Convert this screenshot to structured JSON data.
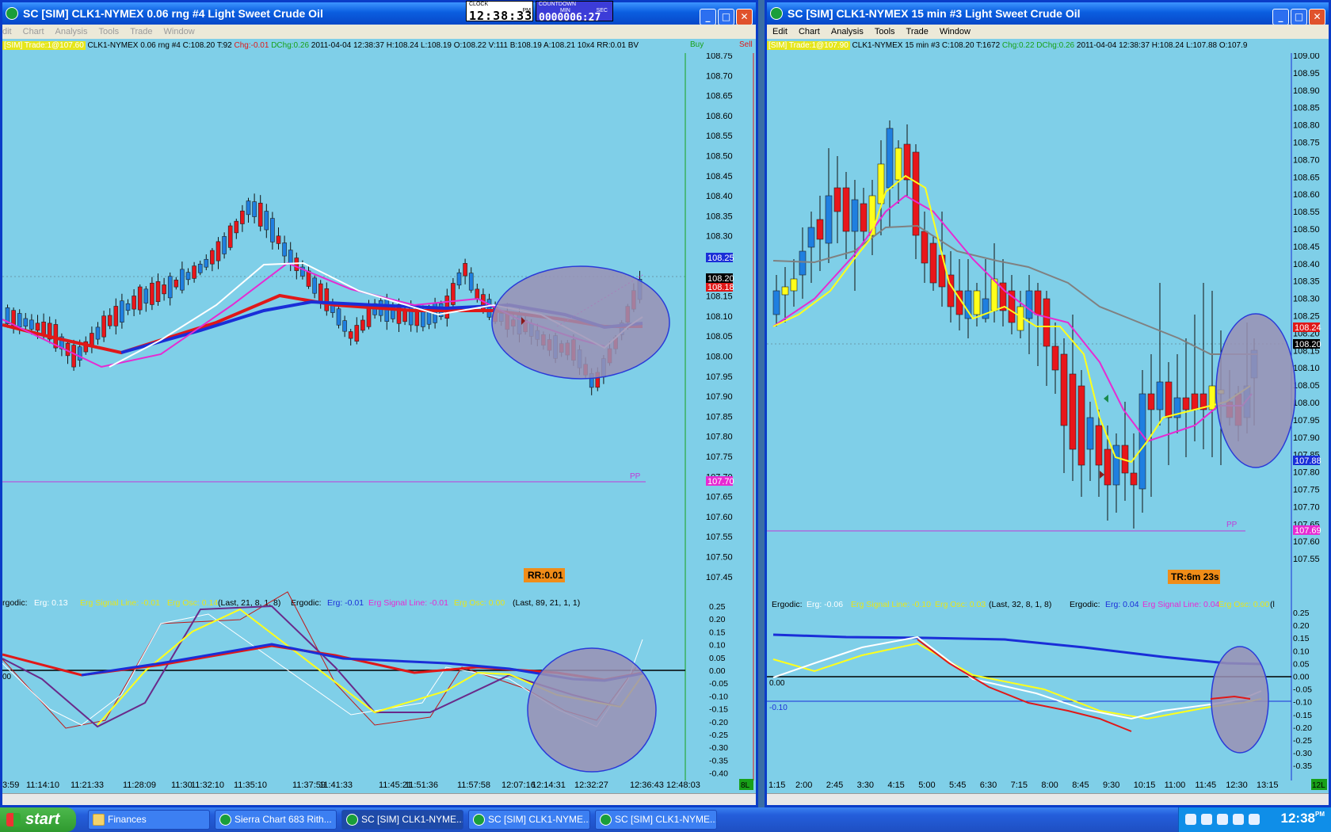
{
  "left_window": {
    "title": "SC [SIM] CLK1-NYMEX  0.06 rng  #4  Light Sweet Crude Oil",
    "menu": [
      "dit",
      "Chart",
      "Analysis",
      "Tools",
      "Trade",
      "Window"
    ],
    "info": {
      "sim": "[SIM] Trade:1@107.60",
      "symbol": "CLK1-NYMEX  0.06 rng  #4",
      "close": "C:108.20",
      "ticks": "T:92",
      "chg": "Chg:-0.01",
      "dchg": "DChg:0.26",
      "rest": "2011-04-04 12:38:37 H:108.24 L:108.19 O:108.22 V:111 B:108.19 A:108.21 10x4 RR:0.01 BV",
      "buy": "Buy",
      "sell": "Sell"
    },
    "price_ticks": [
      "108.75",
      "108.70",
      "108.65",
      "108.60",
      "108.55",
      "108.50",
      "108.45",
      "108.40",
      "108.35",
      "108.30",
      "108.25",
      "108.20",
      "108.15",
      "108.10",
      "108.05",
      "108.00",
      "107.95",
      "107.90",
      "107.85",
      "107.80",
      "107.75",
      "107.70",
      "107.65",
      "107.60",
      "107.55",
      "107.50",
      "107.45"
    ],
    "last_bid_label": "108.25",
    "last_price_label": "108.20",
    "ask_label": "108.18",
    "pp_price_label": "107.70",
    "pp_text": "PP",
    "badge": "RR:0.01",
    "osc_header": {
      "a_name": "rgodic:",
      "a_erg": "Erg: 0.13",
      "a_sig": "Erg Signal Line: -0.01",
      "a_osc": "Erg Osc: 0.14",
      "a_params": "(Last, 21, 8, 1, 8)",
      "b_name": "Ergodic:",
      "b_erg": "Erg: -0.01",
      "b_sig": "Erg Signal Line: -0.01",
      "b_osc": "Erg Osc: 0.00",
      "b_params": "(Last, 89, 21, 1, 1)"
    },
    "osc_ticks": [
      "0.25",
      "0.20",
      "0.15",
      "0.10",
      "0.05",
      "0.00",
      "-0.05",
      "-0.10",
      "-0.15",
      "-0.20",
      "-0.25",
      "-0.30",
      "-0.35",
      "-0.40"
    ],
    "osc_zero_label": "00",
    "time_labels": [
      "3:59",
      "11:14:10",
      "11:21:33",
      "11:28:09",
      "11:30",
      "11:32:10",
      "11:35:10",
      "11:37:59",
      "11:41:33",
      "11:45:21",
      "11:51:36",
      "11:57:58",
      "12:07:16",
      "12:14:31",
      "12:32:27",
      "12:36:43",
      "12:48:03"
    ],
    "corner_badge": "8L"
  },
  "right_window": {
    "title": "SC [SIM] CLK1-NYMEX  15 min  #3  Light Sweet Crude Oil",
    "menu": [
      "Edit",
      "Chart",
      "Analysis",
      "Tools",
      "Trade",
      "Window"
    ],
    "info": {
      "sim": "[SIM] Trade:1@107.90",
      "symbol": "CLK1-NYMEX  15 min",
      "rest1": "#3 C:108.20 T:1672",
      "chg": "Chg:0.22",
      "dchg": "DChg:0.26",
      "rest2": "2011-04-04 12:38:37 H:108.24 L:107.88 O:107.9"
    },
    "price_ticks": [
      "109.00",
      "108.95",
      "108.90",
      "108.85",
      "108.80",
      "108.75",
      "108.70",
      "108.65",
      "108.60",
      "108.55",
      "108.50",
      "108.45",
      "108.40",
      "108.35",
      "108.30",
      "108.25",
      "108.20",
      "108.15",
      "108.10",
      "108.05",
      "108.00",
      "107.95",
      "107.90",
      "107.85",
      "107.80",
      "107.75",
      "107.70",
      "107.65",
      "107.60",
      "107.55"
    ],
    "high_label": "108.24",
    "last_price_label": "108.20",
    "low_label": "107.88",
    "pp_price_label": "107.69",
    "pp_text": "PP",
    "badge": "TR:6m 23s",
    "osc_header": {
      "a_name": "Ergodic:",
      "a_erg": "Erg: -0.06",
      "a_sig": "Erg Signal Line: -0.10",
      "a_osc": "Erg Osc: 0.03",
      "a_params": "(Last, 32, 8, 1, 8)",
      "b_name": "Ergodic:",
      "b_erg": "Erg: 0.04",
      "b_sig": "Erg Signal Line: 0.04",
      "b_osc": "Erg Osc: 0.00",
      "b_params": "(l"
    },
    "osc_ticks": [
      "0.25",
      "0.20",
      "0.15",
      "0.10",
      "0.05",
      "0.00",
      "-0.05",
      "-0.10",
      "-0.15",
      "-0.20",
      "-0.25",
      "-0.30",
      "-0.35"
    ],
    "osc_zero_label": "0.00",
    "osc_ref_label": "-0.10",
    "time_labels": [
      "1:15",
      "2:00",
      "2:45",
      "3:30",
      "4:15",
      "5:00",
      "5:45",
      "6:30",
      "7:15",
      "8:00",
      "8:45",
      "9:30",
      "10:15",
      "11:00",
      "11:45",
      "12:30",
      "13:15"
    ],
    "corner_badge": "12L"
  },
  "clock": {
    "label": "CLOCK",
    "time": "12:38:33",
    "ampm": "PM",
    "countdown_label": "COUNTDOWN",
    "min_label": "MIN",
    "sec_label": "SEC",
    "countdown": "0000006:27"
  },
  "taskbar": {
    "start": "start",
    "items": [
      "Finances",
      "Sierra Chart 683 Rith...",
      "SC [SIM] CLK1-NYME...",
      "SC [SIM] CLK1-NYME...",
      "SC [SIM] CLK1-NYME..."
    ],
    "time": "12:38",
    "time_suffix": "PM"
  },
  "colors": {
    "chart_bg": "#7fcfe8",
    "bull": "#1f7fe0",
    "bear": "#e8161a",
    "ma_red": "#e01818",
    "ma_blue": "#1a2ed8",
    "ma_magenta": "#e62ad2",
    "ma_white": "#ffffff",
    "ma_yellow": "#ffff1a",
    "ma_gray": "#808080",
    "ellipse": "#9a90b4"
  }
}
